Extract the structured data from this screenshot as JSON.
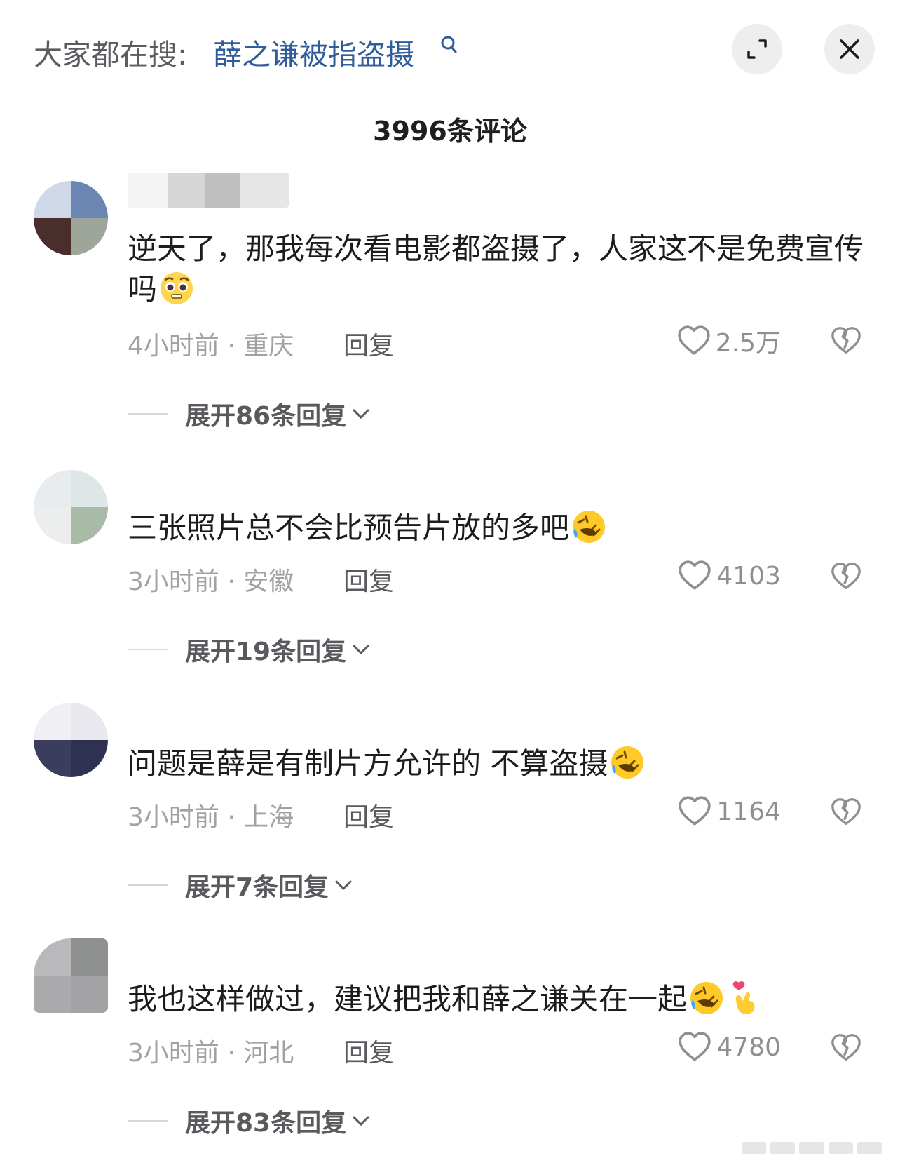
{
  "header": {
    "search_prefix": "大家都在搜:",
    "search_term": "薛之谦被指盗摄",
    "comments_count": "3996条评论"
  },
  "comments": [
    {
      "text": "逆天了，那我每次看电影都盗摄了，人家这不是免费宣传吗",
      "emoji": "pleading-face",
      "time_location": "4小时前 · 重庆",
      "reply_label": "回复",
      "likes": "2.5万",
      "expand_label": "展开86条回复"
    },
    {
      "text": "三张照片总不会比预告片放的多吧",
      "emoji": "rolling-on-floor-laughing",
      "time_location": "3小时前 · 安徽",
      "reply_label": "回复",
      "likes": "4103",
      "expand_label": "展开19条回复"
    },
    {
      "text": "问题是薛是有制片方允许的 不算盗摄",
      "emoji": "rolling-on-floor-laughing",
      "time_location": "3小时前 · 上海",
      "reply_label": "回复",
      "likes": "1164",
      "expand_label": "展开7条回复"
    },
    {
      "text": "我也这样做过，建议把我和薛之谦关在一起",
      "emoji": "rolling-on-floor-laughing, finger-heart",
      "time_location": "3小时前 · 河北",
      "reply_label": "回复",
      "likes": "4780",
      "expand_label": "展开83条回复"
    }
  ],
  "colors": {
    "search_term": "#2f5d9b",
    "meta_text": "#a1a1a6",
    "button_bg": "#eeeeef"
  }
}
